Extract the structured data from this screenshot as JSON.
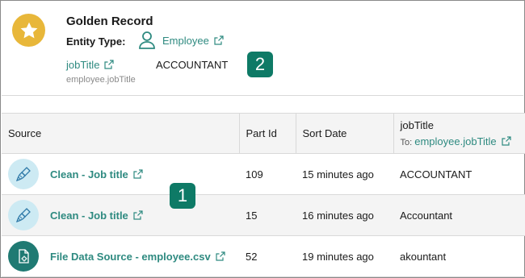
{
  "header": {
    "title": "Golden Record",
    "entity_type_label": "Entity Type:",
    "entity_type_value": "Employee",
    "attribute_name": "jobTitle",
    "attribute_path": "employee.jobTitle",
    "attribute_value": "ACCOUNTANT",
    "badge_icon": "star-icon"
  },
  "callouts": {
    "one": "1",
    "two": "2"
  },
  "table": {
    "columns": {
      "source": "Source",
      "part_id": "Part Id",
      "sort_date": "Sort Date",
      "job_title": "jobTitle",
      "job_title_to_label": "To:",
      "job_title_to_link": "employee.jobTitle"
    },
    "rows": [
      {
        "icon": "cleaning-brush-icon",
        "source": "Clean - Job title",
        "part_id": "109",
        "sort_date": "15 minutes ago",
        "job_title": "ACCOUNTANT"
      },
      {
        "icon": "cleaning-brush-icon",
        "source": "Clean - Job title",
        "part_id": "15",
        "sort_date": "16 minutes ago",
        "job_title": "Accountant"
      },
      {
        "icon": "file-settings-icon",
        "source": "File Data Source - employee.csv",
        "part_id": "52",
        "sort_date": "19 minutes ago",
        "job_title": "akountant"
      }
    ]
  },
  "colors": {
    "accent": "#2e8a80",
    "badge": "#e8b73a",
    "callout": "#0e7a66",
    "clean_icon_bg": "#cdeaf3",
    "file_icon_bg": "#1f7a73"
  }
}
